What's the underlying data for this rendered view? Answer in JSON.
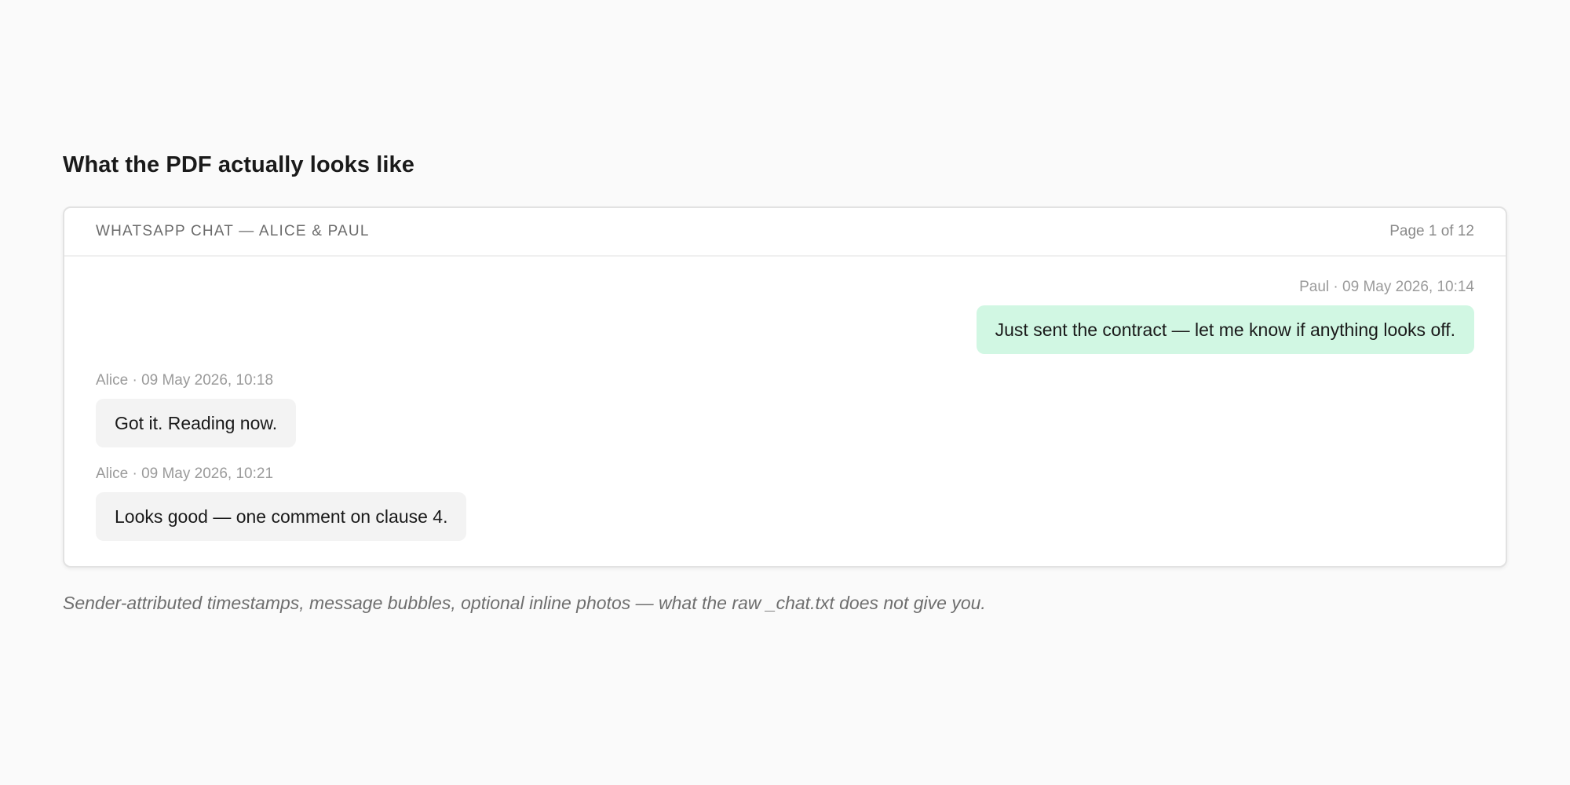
{
  "section": {
    "title": "What the PDF actually looks like"
  },
  "chat": {
    "header": {
      "title": "WHATSAPP CHAT — ALICE & PAUL",
      "page": "Page 1 of 12"
    },
    "messages": [
      {
        "meta": "Paul · 09 May 2026, 10:14",
        "text": "Just sent the contract — let me know if anything looks off."
      },
      {
        "meta": "Alice · 09 May 2026, 10:18",
        "text": "Got it. Reading now."
      },
      {
        "meta": "Alice · 09 May 2026, 10:21",
        "text": "Looks good — one comment on clause 4."
      }
    ]
  },
  "caption": "Sender-attributed timestamps, message bubbles, optional inline photos — what the raw _chat.txt does not give you.",
  "colors": {
    "outgoing_bubble": "#d1f7e3",
    "incoming_bubble": "#f3f3f3",
    "page_background": "#fafafa"
  }
}
